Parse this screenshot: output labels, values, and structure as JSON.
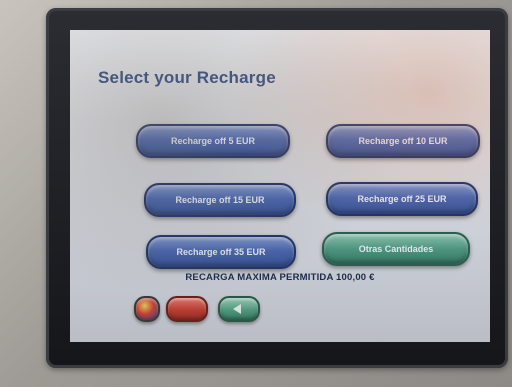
{
  "screen": {
    "title": "Select your Recharge",
    "max_recharge_text": "RECARGA MAXIMA PERMITIDA 100,00 €"
  },
  "recharge_buttons": [
    {
      "label": "Recharge off 5 EUR"
    },
    {
      "label": "Recharge off 10 EUR"
    },
    {
      "label": "Recharge off 15 EUR"
    },
    {
      "label": "Recharge off 25 EUR"
    },
    {
      "label": "Recharge off 35 EUR"
    },
    {
      "label": "Otras Cantidades"
    }
  ],
  "bottom_bar": {
    "language_icon": "language-flag-icon",
    "cancel_label": "",
    "back_icon": "arrow-left-icon"
  },
  "colors": {
    "title": "#1f3f7a",
    "button_blue": "#3f5ea8",
    "button_green": "#4c9a82",
    "cancel_red": "#c7392c"
  }
}
